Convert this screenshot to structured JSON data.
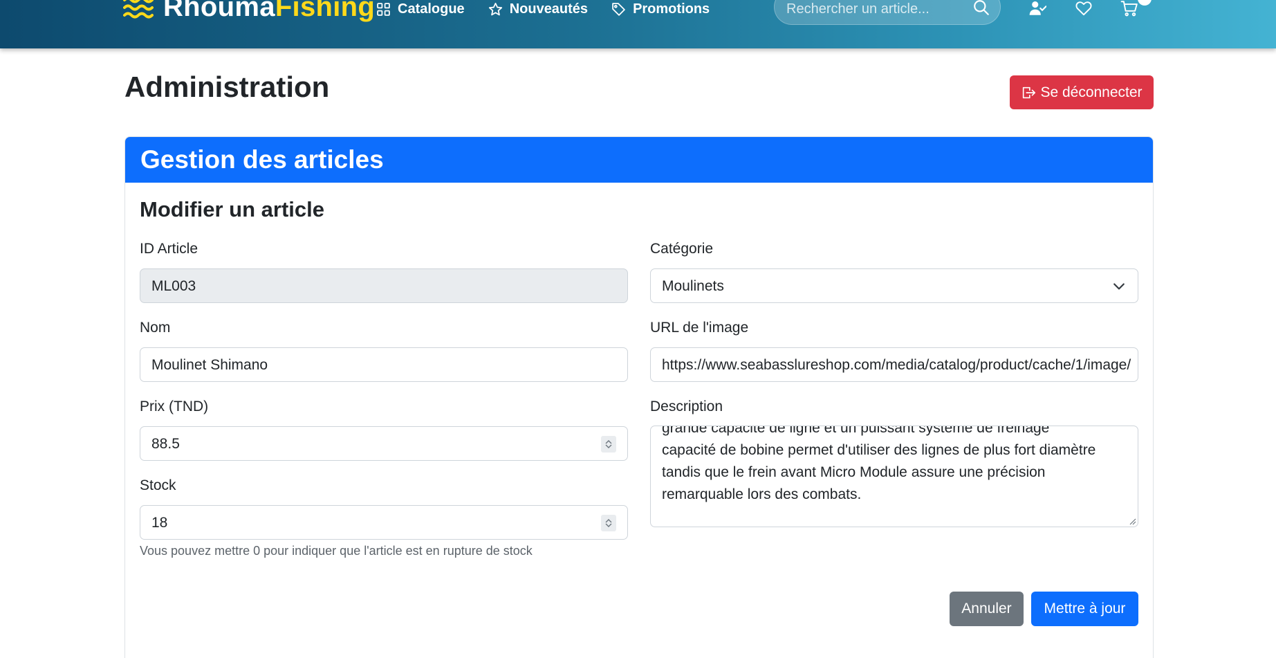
{
  "navbar": {
    "brand_part1": "Rhouma",
    "brand_part2": "Fishing",
    "links": [
      {
        "label": "Catalogue",
        "icon": "grid-icon"
      },
      {
        "label": "Nouveautés",
        "icon": "star-icon"
      },
      {
        "label": "Promotions",
        "icon": "tag-icon"
      }
    ],
    "search_placeholder": "Rechercher un article...",
    "icons": [
      "search-icon",
      "user-check-icon",
      "heart-icon",
      "cart-icon"
    ]
  },
  "header": {
    "title": "Administration",
    "logout_label": "Se déconnecter"
  },
  "card": {
    "title": "Gestion des articles",
    "form_title": "Modifier un article"
  },
  "form": {
    "id_label": "ID Article",
    "id_value": "ML003",
    "name_label": "Nom",
    "name_value": "Moulinet Shimano",
    "price_label": "Prix (TND)",
    "price_value": "88.5",
    "stock_label": "Stock",
    "stock_value": "18",
    "stock_help": "Vous pouvez mettre 0 pour indiquer que l'article est en rupture de stock",
    "category_label": "Catégorie",
    "category_value": "Moulinets",
    "image_label": "URL de l'image",
    "image_value": "https://www.seabasslureshop.com/media/catalog/product/cache/1/image/",
    "description_label": "Description",
    "description_lines": [
      "grande capacité de ligne et un puissant système de freinage",
      "capacité de bobine permet d'utiliser des lignes de plus fort diamètre",
      "tandis que le frein avant Micro Module assure une précision",
      "remarquable lors des combats."
    ]
  },
  "actions": {
    "cancel_label": "Annuler",
    "update_label": "Mettre à jour"
  },
  "colors": {
    "primary": "#0d6efd",
    "danger": "#dc3545",
    "secondary": "#6c757d",
    "brand_accent": "#ffd91a"
  }
}
